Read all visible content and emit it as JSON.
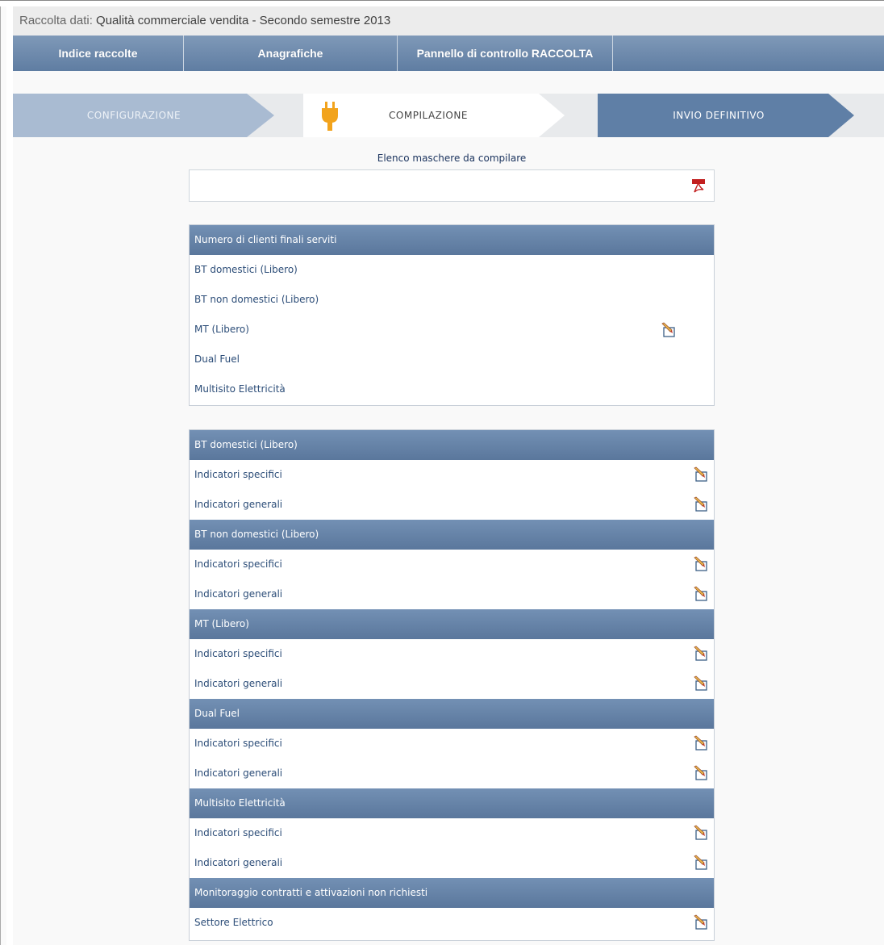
{
  "header": {
    "title_prefix": "Raccolta dati: ",
    "title_main": "Qualità commerciale vendita - Secondo semestre 2013"
  },
  "nav": {
    "items": [
      {
        "label": "Indice raccolte"
      },
      {
        "label": "Anagrafiche"
      },
      {
        "label": "Pannello di controllo RACCOLTA"
      },
      {
        "label": ""
      }
    ]
  },
  "wizard": {
    "steps": [
      {
        "label": "CONFIGURAZIONE"
      },
      {
        "label": "COMPILAZIONE"
      },
      {
        "label": "INVIO DEFINITIVO"
      }
    ]
  },
  "elenco": {
    "title": "Elenco maschere da compilare"
  },
  "clienti_table": {
    "header": "Numero di clienti finali serviti",
    "rows": [
      {
        "label": "BT domestici (Libero)"
      },
      {
        "label": "BT non domestici (Libero)"
      },
      {
        "label": "MT (Libero)"
      },
      {
        "label": "Dual Fuel"
      },
      {
        "label": "Multisito Elettricità"
      }
    ]
  },
  "sections": [
    {
      "header": "BT domestici (Libero)",
      "rows": [
        {
          "label": "Indicatori specifici"
        },
        {
          "label": "Indicatori generali"
        }
      ]
    },
    {
      "header": "BT non domestici (Libero)",
      "rows": [
        {
          "label": "Indicatori specifici"
        },
        {
          "label": "Indicatori generali"
        }
      ]
    },
    {
      "header": "MT (Libero)",
      "rows": [
        {
          "label": "Indicatori specifici"
        },
        {
          "label": "Indicatori generali"
        }
      ]
    },
    {
      "header": "Dual Fuel",
      "rows": [
        {
          "label": "Indicatori specifici"
        },
        {
          "label": "Indicatori generali"
        }
      ]
    },
    {
      "header": "Multisito Elettricità",
      "rows": [
        {
          "label": "Indicatori specifici"
        },
        {
          "label": "Indicatori generali"
        }
      ]
    },
    {
      "header": "Monitoraggio contratti e attivazioni non richiesti",
      "rows": [
        {
          "label": "Settore Elettrico"
        }
      ]
    }
  ],
  "icons": {
    "plug": "plug-icon",
    "pdf": "pdf-icon",
    "edit": "edit-icon"
  },
  "colors": {
    "nav": "#5f7da2",
    "step_done": "#a9bbd2",
    "step_next": "#5f7fa6",
    "plug": "#f2a31c",
    "link": "#2c4d78"
  }
}
